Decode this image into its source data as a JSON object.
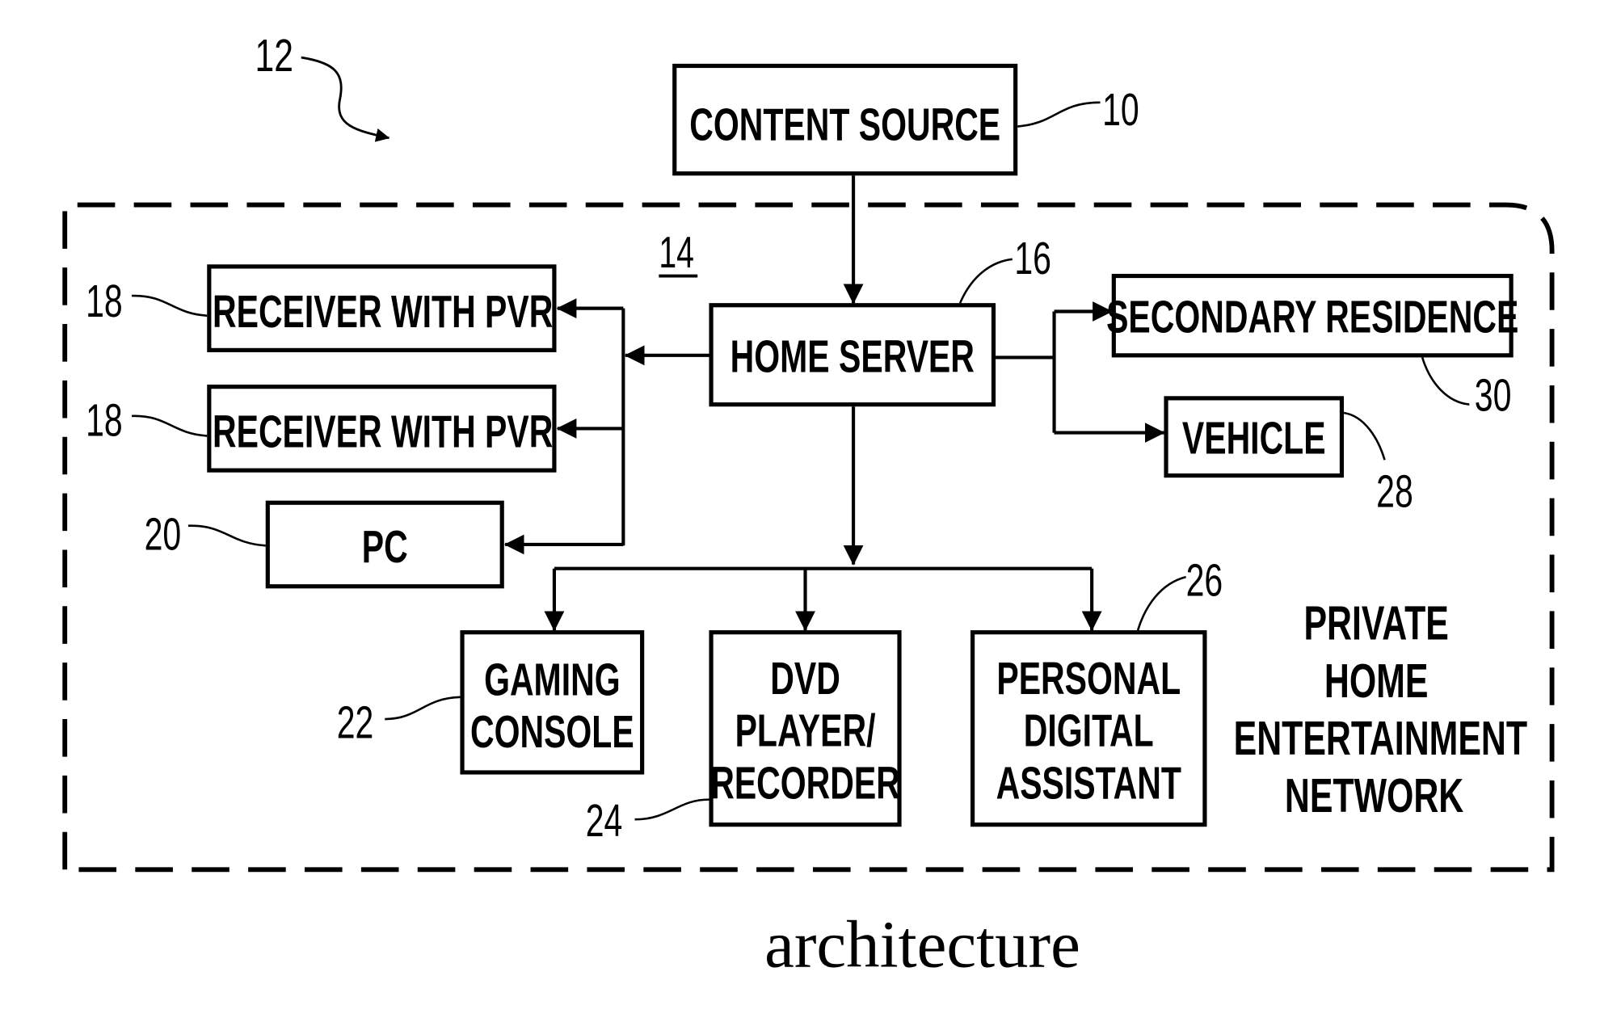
{
  "figure": {
    "caption": "architecture",
    "network_ref": "12",
    "network_area_ref": "14",
    "network_label_lines": [
      "PRIVATE",
      "HOME",
      "ENTERTAINMENT",
      "NETWORK"
    ]
  },
  "blocks": {
    "content_source": {
      "label_lines": [
        "CONTENT SOURCE"
      ],
      "ref": "10"
    },
    "home_server": {
      "label_lines": [
        "HOME SERVER"
      ],
      "ref": "16"
    },
    "receiver_1": {
      "label_lines": [
        "RECEIVER WITH PVR"
      ],
      "ref": "18"
    },
    "receiver_2": {
      "label_lines": [
        "RECEIVER WITH PVR"
      ],
      "ref": "18"
    },
    "pc": {
      "label_lines": [
        "PC"
      ],
      "ref": "20"
    },
    "gaming_console": {
      "label_lines": [
        "GAMING",
        "CONSOLE"
      ],
      "ref": "22"
    },
    "dvd": {
      "label_lines": [
        "DVD",
        "PLAYER/",
        "RECORDER"
      ],
      "ref": "24"
    },
    "pda": {
      "label_lines": [
        "PERSONAL",
        "DIGITAL",
        "ASSISTANT"
      ],
      "ref": "26"
    },
    "vehicle": {
      "label_lines": [
        "VEHICLE"
      ],
      "ref": "28"
    },
    "secondary_residence": {
      "label_lines": [
        "SECONDARY RESIDENCE"
      ],
      "ref": "30"
    }
  },
  "connections": [
    {
      "from": "content_source",
      "to": "home_server"
    },
    {
      "from": "home_server",
      "to": "receiver_1"
    },
    {
      "from": "home_server",
      "to": "receiver_2"
    },
    {
      "from": "home_server",
      "to": "pc"
    },
    {
      "from": "home_server",
      "to": "secondary_residence"
    },
    {
      "from": "home_server",
      "to": "vehicle"
    },
    {
      "from": "home_server",
      "to": "gaming_console"
    },
    {
      "from": "home_server",
      "to": "dvd"
    },
    {
      "from": "home_server",
      "to": "pda"
    }
  ]
}
